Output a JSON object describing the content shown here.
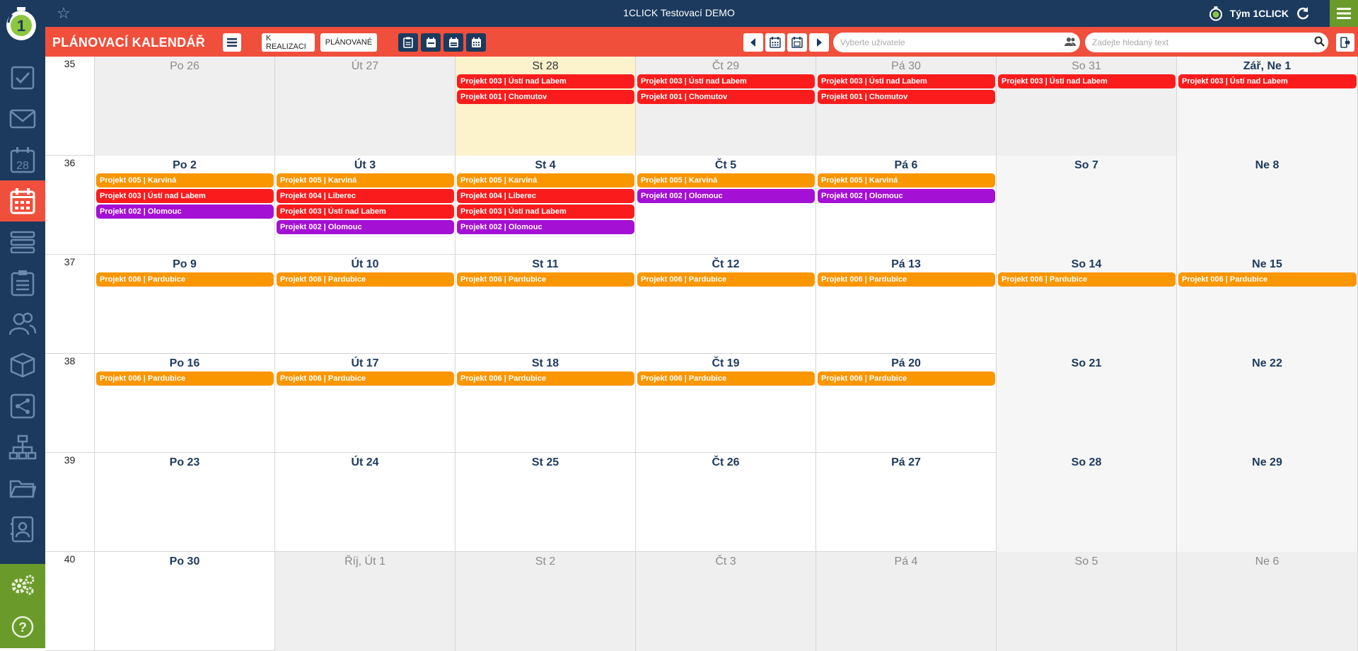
{
  "app_title": "1CLICK Testovací DEMO",
  "team_label": "Tým 1CLICK",
  "page_title": "PLÁNOVACÍ KALENDÁŘ",
  "toolbar": {
    "realizace_label": "K REALIZACI",
    "planovane_label": "PLÁNOVANÉ",
    "user_placeholder": "Vyberte uživatele",
    "search_placeholder": "Zadejte hledaný text"
  },
  "colors": {
    "navy": "#1c3a5e",
    "accent_red": "#f04f3c",
    "green": "#6a9a2a",
    "event_red": "#fa1c1c",
    "event_orange": "#fa9600",
    "event_purple": "#a410d4",
    "today_bg": "#fcf2cc"
  },
  "sidebar": {
    "items": [
      "check-icon",
      "mail-icon",
      "calendar-28-icon",
      "planning-calendar-icon",
      "list-icon",
      "clipboard-icon",
      "users-icon",
      "box-icon",
      "share-icon",
      "org-chart-icon",
      "folder-icon",
      "contacts-icon"
    ],
    "active": "planning-calendar-icon",
    "calendar_day": "28",
    "bottom": [
      "settings-icon",
      "help-icon"
    ]
  },
  "weeks": [
    {
      "num": "35",
      "days": [
        {
          "label": "Po 26",
          "type": "other",
          "events": []
        },
        {
          "label": "Út 27",
          "type": "other",
          "events": []
        },
        {
          "label": "St 28",
          "type": "today",
          "events": [
            {
              "text": "Projekt 003 | Ústí nad Labem",
              "color": "red"
            },
            {
              "text": "Projekt 001 | Chomutov",
              "color": "red"
            }
          ]
        },
        {
          "label": "Čt 29",
          "type": "other",
          "events": [
            {
              "text": "Projekt 003 | Ústí nad Labem",
              "color": "red"
            },
            {
              "text": "Projekt 001 | Chomutov",
              "color": "red"
            }
          ]
        },
        {
          "label": "Pá 30",
          "type": "other",
          "events": [
            {
              "text": "Projekt 003 | Ústí nad Labem",
              "color": "red"
            },
            {
              "text": "Projekt 001 | Chomutov",
              "color": "red"
            }
          ]
        },
        {
          "label": "So 31",
          "type": "other",
          "events": [
            {
              "text": "Projekt 003 | Ústí nad Labem",
              "color": "red"
            }
          ]
        },
        {
          "label": "Zář, Ne 1",
          "type": "weekend-strong",
          "events": [
            {
              "text": "Projekt 003 | Ústí nad Labem",
              "color": "red"
            }
          ]
        }
      ]
    },
    {
      "num": "36",
      "days": [
        {
          "label": "Po 2",
          "type": "normal",
          "events": [
            {
              "text": "Projekt 005 | Karviná",
              "color": "orange"
            },
            {
              "text": "Projekt 003 | Ústí nad Labem",
              "color": "red"
            },
            {
              "text": "Projekt 002 | Olomouc",
              "color": "purple"
            }
          ]
        },
        {
          "label": "Út 3",
          "type": "normal",
          "events": [
            {
              "text": "Projekt 005 | Karviná",
              "color": "orange"
            },
            {
              "text": "Projekt 004 | Liberec",
              "color": "red"
            },
            {
              "text": "Projekt 003 | Ústí nad Labem",
              "color": "red"
            },
            {
              "text": "Projekt 002 | Olomouc",
              "color": "purple"
            }
          ]
        },
        {
          "label": "St 4",
          "type": "normal",
          "events": [
            {
              "text": "Projekt 005 | Karviná",
              "color": "orange"
            },
            {
              "text": "Projekt 004 | Liberec",
              "color": "red"
            },
            {
              "text": "Projekt 003 | Ústí nad Labem",
              "color": "red"
            },
            {
              "text": "Projekt 002 | Olomouc",
              "color": "purple"
            }
          ]
        },
        {
          "label": "Čt 5",
          "type": "normal",
          "events": [
            {
              "text": "Projekt 005 | Karviná",
              "color": "orange"
            },
            {
              "text": "Projekt 002 | Olomouc",
              "color": "purple"
            }
          ]
        },
        {
          "label": "Pá 6",
          "type": "normal",
          "events": [
            {
              "text": "Projekt 005 | Karviná",
              "color": "orange"
            },
            {
              "text": "Projekt 002 | Olomouc",
              "color": "purple"
            }
          ]
        },
        {
          "label": "So 7",
          "type": "weekend",
          "events": []
        },
        {
          "label": "Ne 8",
          "type": "weekend",
          "events": []
        }
      ]
    },
    {
      "num": "37",
      "days": [
        {
          "label": "Po 9",
          "type": "normal",
          "events": [
            {
              "text": "Projekt 006 | Pardubice",
              "color": "orange"
            }
          ]
        },
        {
          "label": "Út 10",
          "type": "normal",
          "events": [
            {
              "text": "Projekt 006 | Pardubice",
              "color": "orange"
            }
          ]
        },
        {
          "label": "St 11",
          "type": "normal",
          "events": [
            {
              "text": "Projekt 006 | Pardubice",
              "color": "orange"
            }
          ]
        },
        {
          "label": "Čt 12",
          "type": "normal",
          "events": [
            {
              "text": "Projekt 006 | Pardubice",
              "color": "orange"
            }
          ]
        },
        {
          "label": "Pá 13",
          "type": "normal",
          "events": [
            {
              "text": "Projekt 006 | Pardubice",
              "color": "orange"
            }
          ]
        },
        {
          "label": "So 14",
          "type": "weekend",
          "events": [
            {
              "text": "Projekt 006 | Pardubice",
              "color": "orange"
            }
          ]
        },
        {
          "label": "Ne 15",
          "type": "weekend",
          "events": [
            {
              "text": "Projekt 006 | Pardubice",
              "color": "orange"
            }
          ]
        }
      ]
    },
    {
      "num": "38",
      "days": [
        {
          "label": "Po 16",
          "type": "normal",
          "events": [
            {
              "text": "Projekt 006 | Pardubice",
              "color": "orange"
            }
          ]
        },
        {
          "label": "Út 17",
          "type": "normal",
          "events": [
            {
              "text": "Projekt 006 | Pardubice",
              "color": "orange"
            }
          ]
        },
        {
          "label": "St 18",
          "type": "normal",
          "events": [
            {
              "text": "Projekt 006 | Pardubice",
              "color": "orange"
            }
          ]
        },
        {
          "label": "Čt 19",
          "type": "normal",
          "events": [
            {
              "text": "Projekt 006 | Pardubice",
              "color": "orange"
            }
          ]
        },
        {
          "label": "Pá 20",
          "type": "normal",
          "events": [
            {
              "text": "Projekt 006 | Pardubice",
              "color": "orange"
            }
          ]
        },
        {
          "label": "So 21",
          "type": "weekend",
          "events": []
        },
        {
          "label": "Ne 22",
          "type": "weekend",
          "events": []
        }
      ]
    },
    {
      "num": "39",
      "days": [
        {
          "label": "Po 23",
          "type": "normal",
          "events": []
        },
        {
          "label": "Út 24",
          "type": "normal",
          "events": []
        },
        {
          "label": "St 25",
          "type": "normal",
          "events": []
        },
        {
          "label": "Čt 26",
          "type": "normal",
          "events": []
        },
        {
          "label": "Pá 27",
          "type": "normal",
          "events": []
        },
        {
          "label": "So 28",
          "type": "weekend",
          "events": []
        },
        {
          "label": "Ne 29",
          "type": "weekend",
          "events": []
        }
      ]
    },
    {
      "num": "40",
      "days": [
        {
          "label": "Po 30",
          "type": "normal",
          "events": []
        },
        {
          "label": "Říj, Út 1",
          "type": "other",
          "events": []
        },
        {
          "label": "St 2",
          "type": "other",
          "events": []
        },
        {
          "label": "Čt 3",
          "type": "other",
          "events": []
        },
        {
          "label": "Pá 4",
          "type": "other",
          "events": []
        },
        {
          "label": "So 5",
          "type": "other",
          "events": []
        },
        {
          "label": "Ne 6",
          "type": "other",
          "events": []
        }
      ]
    }
  ]
}
